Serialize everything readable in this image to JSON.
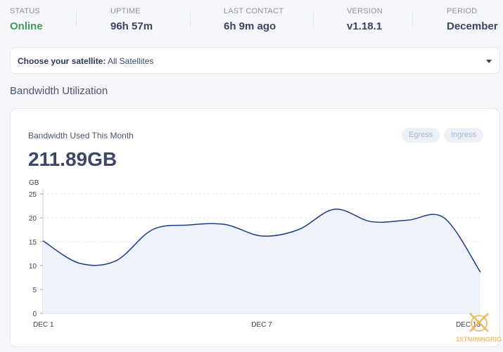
{
  "status_bar": {
    "items": [
      {
        "label": "STATUS",
        "value": "Online"
      },
      {
        "label": "UPTIME",
        "value": "96h 57m"
      },
      {
        "label": "LAST CONTACT",
        "value": "6h 9m ago"
      },
      {
        "label": "VERSION",
        "value": "v1.18.1"
      },
      {
        "label": "PERIOD",
        "value": "December"
      }
    ]
  },
  "satellite_select": {
    "label": "Choose your satellite:",
    "value": "All Satellites"
  },
  "bandwidth": {
    "section_title": "Bandwidth Utilization",
    "card_title": "Bandwidth Used This Month",
    "total": "211.89GB",
    "legend": [
      "Egress",
      "Ingress"
    ]
  },
  "colors": {
    "online": "#3f9c57",
    "line": "#1f3a8a",
    "fill": "#eef2fb"
  },
  "watermark": {
    "text": "1STMININGRIG"
  },
  "chart_data": {
    "type": "area",
    "ylabel": "GB",
    "yticks": [
      0,
      5,
      10,
      15,
      20,
      25
    ],
    "ylim": [
      0,
      25
    ],
    "xlim": [
      1,
      13
    ],
    "x_tick_labels": [
      {
        "x": 1,
        "label": "DEC 1"
      },
      {
        "x": 7,
        "label": "DEC 7"
      },
      {
        "x": 13,
        "label": "DEC 13"
      }
    ],
    "series": [
      {
        "x": [
          1,
          2,
          3,
          4,
          5,
          6,
          7,
          8,
          9,
          10,
          11,
          12,
          13
        ],
        "values": [
          15.2,
          10.5,
          11.0,
          17.5,
          18.5,
          18.6,
          16.2,
          17.5,
          21.8,
          19.2,
          19.5,
          20.0,
          8.6
        ]
      }
    ],
    "grid": true
  }
}
